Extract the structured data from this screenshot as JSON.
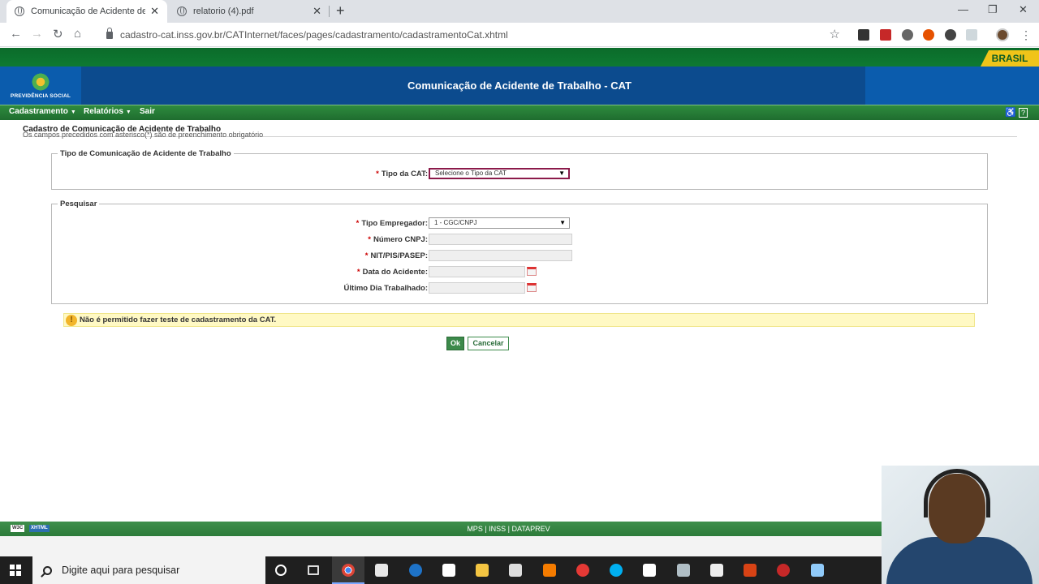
{
  "browser": {
    "tabs": [
      {
        "title": "Comunicação de Acidente de Trab",
        "active": true
      },
      {
        "title": "relatorio (4).pdf",
        "active": false
      }
    ],
    "url": "cadastro-cat.inss.gov.br/CATInternet/faces/pages/cadastramento/cadastramentoCat.xhtml",
    "icons": [
      "back-icon",
      "forward-icon",
      "reload-icon",
      "home-icon",
      "lock-icon",
      "star-icon",
      "menu-icon"
    ]
  },
  "gov": {
    "brasil_label": "BRASIL",
    "logo_text": "PREVIDÊNCIA SOCIAL",
    "banner_title": "Comunicação de Acidente de Trabalho - CAT"
  },
  "menu": {
    "items": [
      "Cadastramento",
      "Relatórios",
      "Sair"
    ]
  },
  "page": {
    "title": "Cadastro de Comunicação de Acidente de Trabalho",
    "subtitle": "Os campos precedidos com asterisco(*) são de preenchimento obrigatório"
  },
  "tipo_section": {
    "legend": "Tipo de Comunicação de Acidente de Trabalho",
    "label": "Tipo da CAT:",
    "select_value": "Selecione o Tipo da CAT"
  },
  "pesquisar": {
    "legend": "Pesquisar",
    "tipo_empregador_label": "Tipo Empregador:",
    "tipo_empregador_value": "1 - CGC/CNPJ",
    "cnpj_label": "Número CNPJ:",
    "nit_label": "NIT/PIS/PASEP:",
    "data_acidente_label": "Data do Acidente:",
    "ultimo_dia_label": "Último Dia Trabalhado:"
  },
  "required_mark": "*",
  "warning": {
    "icon": "!",
    "text": "Não é permitido fazer teste de cadastramento da CAT."
  },
  "buttons": {
    "ok": "Ok",
    "cancel": "Cancelar"
  },
  "footer": {
    "badge_w3c": "W3C",
    "badge_xhtml": "XHTML",
    "text": "MPS | INSS | DATAPREV"
  },
  "taskbar": {
    "search_placeholder": "Digite aqui para pesquisar"
  },
  "colors": {
    "gov_green": "#0e7a32",
    "banner_blue": "#0c4b8e",
    "menu_green": "#2e8b3e",
    "focus_border": "#8b1a4a",
    "warning_bg": "#fff9c4"
  }
}
